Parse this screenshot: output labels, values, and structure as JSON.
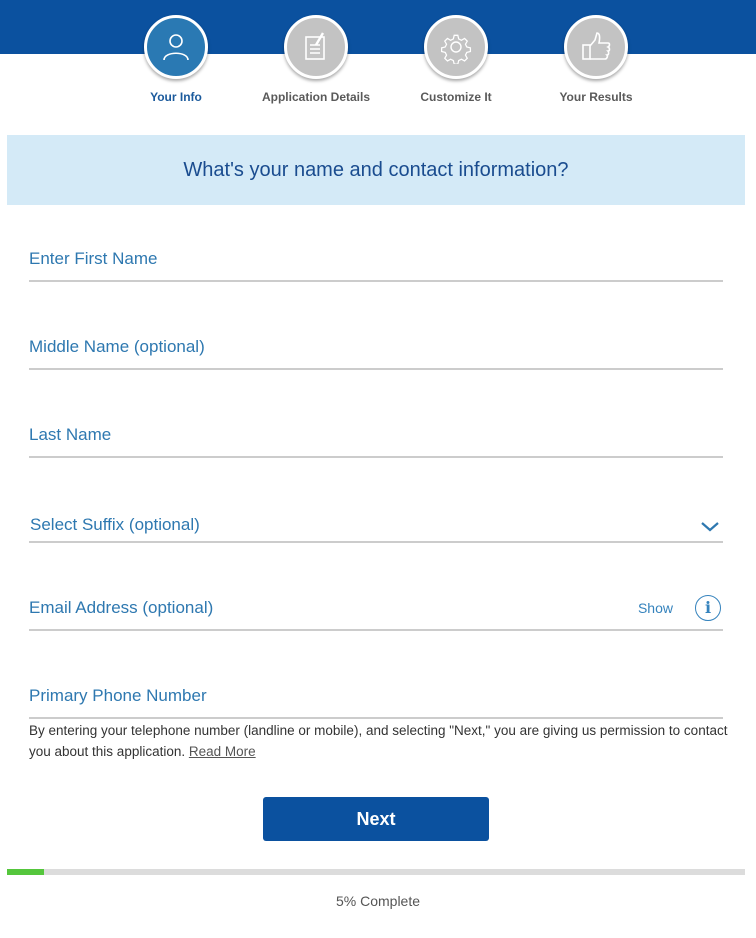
{
  "colors": {
    "brand_blue": "#0b519f",
    "banner_bg": "#d4eaf7",
    "active_step": "#2a79b3",
    "inactive_step": "#c3c3c3",
    "progress_fill": "#55c63c"
  },
  "steps": [
    {
      "label": "Your Info",
      "icon": "person-icon",
      "active": true
    },
    {
      "label": "Application Details",
      "icon": "document-edit-icon",
      "active": false
    },
    {
      "label": "Customize It",
      "icon": "gear-icon",
      "active": false
    },
    {
      "label": "Your Results",
      "icon": "thumbs-up-icon",
      "active": false
    }
  ],
  "banner": {
    "title": "What's your name and contact information?"
  },
  "form": {
    "first_name": {
      "placeholder": "Enter First Name",
      "value": ""
    },
    "middle_name": {
      "placeholder": "Middle Name (optional)",
      "value": ""
    },
    "last_name": {
      "placeholder": "Last Name",
      "value": ""
    },
    "suffix": {
      "placeholder": "Select Suffix (optional)",
      "selected": ""
    },
    "email": {
      "placeholder": "Email Address (optional)",
      "value": "",
      "show_label": "Show"
    },
    "phone": {
      "placeholder": "Primary Phone Number",
      "value": ""
    }
  },
  "disclaimer": {
    "text": "By entering your telephone number (landline or mobile), and selecting \"Next,\" you are giving us permission to contact you about this application. ",
    "link": "Read More"
  },
  "next_button": "Next",
  "progress": {
    "percent": 5,
    "label": "5% Complete"
  }
}
